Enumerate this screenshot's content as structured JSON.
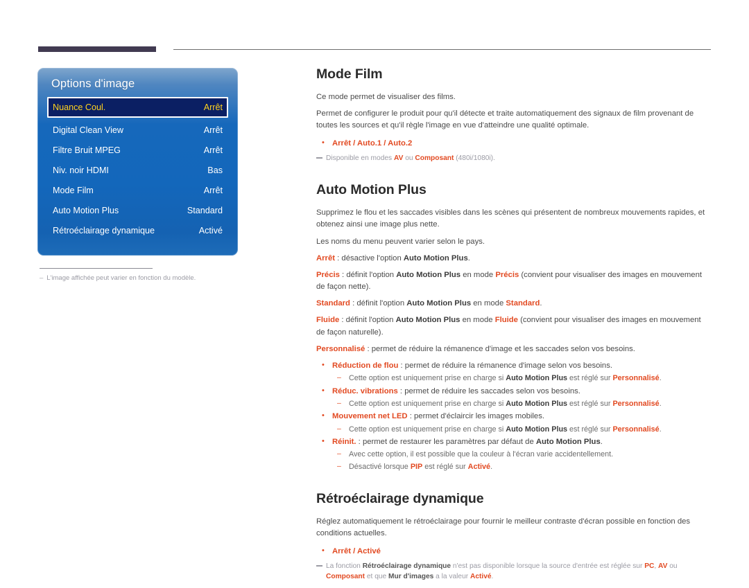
{
  "page": {
    "title": "Options d'image"
  },
  "osd": {
    "title": "Options d'image",
    "rows": [
      {
        "label": "Nuance Coul.",
        "value": "Arrêt",
        "selected": true
      },
      {
        "label": "Digital Clean View",
        "value": "Arrêt",
        "selected": false
      },
      {
        "label": "Filtre Bruit MPEG",
        "value": "Arrêt",
        "selected": false
      },
      {
        "label": "Niv. noir HDMI",
        "value": "Bas",
        "selected": false
      },
      {
        "label": "Mode Film",
        "value": "Arrêt",
        "selected": false
      },
      {
        "label": "Auto Motion Plus",
        "value": "Standard",
        "selected": false
      },
      {
        "label": "Rétroéclairage dynamique",
        "value": "Activé",
        "selected": false
      }
    ],
    "note_dash": "–",
    "note": "L'image affichée peut varier en fonction du modèle."
  },
  "sections": {
    "mode_film": {
      "title": "Mode Film",
      "p1": "Ce mode permet de visualiser des films.",
      "p2": "Permet de configurer le produit pour qu'il détecte et traite automatiquement des signaux de film provenant de toutes les sources et qu'il règle l'image en vue d'atteindre une qualité optimale.",
      "options": "Arrêt / Auto.1 / Auto.2",
      "note_parts": {
        "a": "Disponible en modes ",
        "b": "AV",
        "c": " ou ",
        "d": "Composant",
        "e": " (480i/1080i)."
      }
    },
    "auto_motion_plus": {
      "title": "Auto Motion Plus",
      "p1": "Supprimez le flou et les saccades visibles dans les scènes qui présentent de nombreux mouvements rapides, et obtenez ainsi une image plus nette.",
      "p2": "Les noms du menu peuvent varier selon le pays.",
      "modes": [
        {
          "name": "Arrêt",
          "text_a": " : désactive l'option ",
          "ref": "Auto Motion Plus",
          "text_b": "."
        },
        {
          "name": "Précis",
          "text_a": " : définit l'option ",
          "ref": "Auto Motion Plus",
          "text_b": " en mode ",
          "ref2": "Précis",
          "text_c": " (convient pour visualiser des images en mouvement de façon nette)."
        },
        {
          "name": "Standard",
          "text_a": " : définit l'option ",
          "ref": "Auto Motion Plus",
          "text_b": " en mode ",
          "ref2": "Standard",
          "text_c": "."
        },
        {
          "name": "Fluide",
          "text_a": " : définit l'option ",
          "ref": "Auto Motion Plus",
          "text_b": " en mode ",
          "ref2": "Fluide",
          "text_c": " (convient pour visualiser des images en mouvement de façon naturelle)."
        },
        {
          "name": "Personnalisé",
          "text_a": " : permet de réduire la rémanence d'image et les saccades selon vos besoins.",
          "ref": "",
          "text_b": ""
        }
      ],
      "sub_items": [
        {
          "name": "Réduction de flou",
          "desc": " : permet de réduire la rémanence d'image selon vos besoins.",
          "notes": [
            {
              "a": "Cette option est uniquement prise en charge si ",
              "b": "Auto Motion Plus",
              "c": " est réglé sur ",
              "d": "Personnalisé",
              "e": "."
            }
          ]
        },
        {
          "name": "Réduc. vibrations",
          "desc": " : permet de réduire les saccades selon vos besoins.",
          "notes": [
            {
              "a": "Cette option est uniquement prise en charge si ",
              "b": "Auto Motion Plus",
              "c": " est réglé sur ",
              "d": "Personnalisé",
              "e": "."
            }
          ]
        },
        {
          "name": "Mouvement net LED",
          "desc": " : permet d'éclaircir les images mobiles.",
          "notes": [
            {
              "a": "Cette option est uniquement prise en charge si ",
              "b": "Auto Motion Plus",
              "c": " est réglé sur ",
              "d": "Personnalisé",
              "e": "."
            }
          ]
        },
        {
          "name": "Réinit.",
          "desc": " : permet de restaurer les paramètres par défaut de ",
          "desc_ref": "Auto Motion Plus",
          "desc_end": ".",
          "notes": [
            {
              "a": "Avec cette option, il est possible que la couleur à l'écran varie accidentellement.",
              "b": "",
              "c": "",
              "d": "",
              "e": ""
            },
            {
              "a": "Désactivé lorsque ",
              "b": "PIP",
              "c": " est réglé sur ",
              "d": "Activé",
              "e": "."
            }
          ]
        }
      ]
    },
    "retro": {
      "title": "Rétroéclairage dynamique",
      "p1": "Réglez automatiquement le rétroéclairage pour fournir le meilleur contraste d'écran possible en fonction des conditions actuelles.",
      "options": "Arrêt / Activé",
      "note_parts": {
        "a": "La fonction ",
        "b": "Rétroéclairage dynamique",
        "c": " n'est pas disponible lorsque la source d'entrée est réglée sur ",
        "d": "PC",
        "e": ", ",
        "f": "AV",
        "g": " ou ",
        "h": "Composant",
        "i": " et que ",
        "j": "Mur d'images",
        "k": " a la valeur ",
        "l": "Activé",
        "m": "."
      }
    }
  },
  "colors": {
    "accent_red": "#e24a22",
    "osd_blue": "#1668bb",
    "osd_selected_bg": "#0b1f63",
    "osd_selected_text": "#ffd21e",
    "top_bar_dark": "#413a51"
  }
}
